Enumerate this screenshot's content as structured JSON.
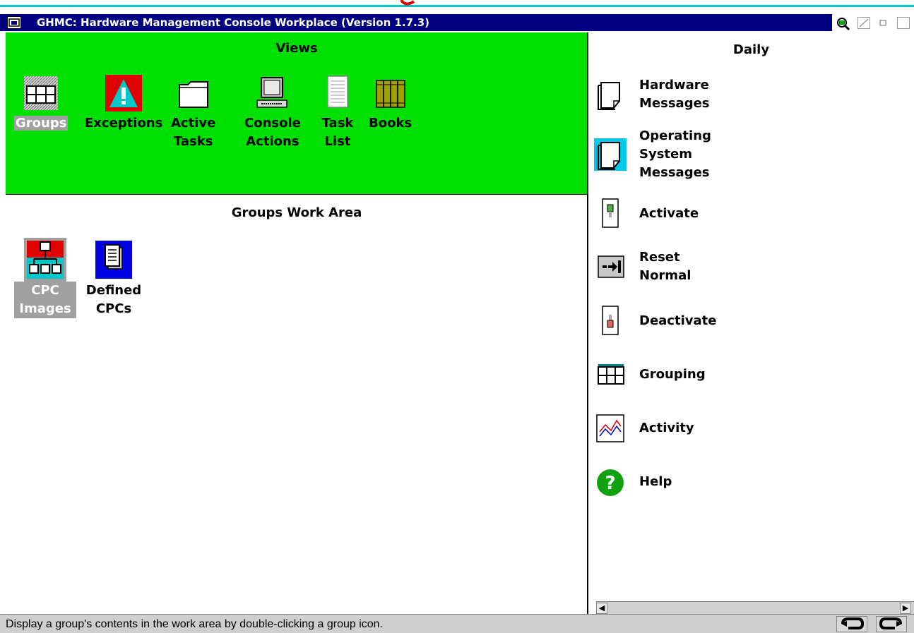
{
  "window": {
    "title": "GHMC: Hardware Management Console Workplace (Version 1.7.3)",
    "icons": [
      "system-menu-icon",
      "magnifier-icon",
      "minimize-icon",
      "restore-icon",
      "maximize-icon"
    ]
  },
  "views": {
    "header": "Views",
    "items": [
      {
        "label": "Groups",
        "icon": "groups-icon",
        "selected": true
      },
      {
        "label": "Exceptions",
        "icon": "exceptions-icon",
        "selected": false
      },
      {
        "label": "Active\nTasks",
        "icon": "folder-icon",
        "selected": false
      },
      {
        "label": "Console\nActions",
        "icon": "console-icon",
        "selected": false
      },
      {
        "label": "Task\nList",
        "icon": "task-list-icon",
        "selected": false
      },
      {
        "label": "Books",
        "icon": "books-icon",
        "selected": false
      }
    ]
  },
  "work_area": {
    "header": "Groups Work Area",
    "items": [
      {
        "label": "CPC\nImages",
        "icon": "cpc-images-icon",
        "selected": true
      },
      {
        "label": "Defined\nCPCs",
        "icon": "defined-cpcs-icon",
        "selected": false
      }
    ]
  },
  "daily": {
    "header": "Daily",
    "items": [
      {
        "label": "Hardware\nMessages",
        "icon": "document-icon"
      },
      {
        "label": "Operating\nSystem\nMessages",
        "icon": "document-icon"
      },
      {
        "label": "Activate",
        "icon": "switch-on-icon"
      },
      {
        "label": "Reset\nNormal",
        "icon": "reset-arrow-icon"
      },
      {
        "label": "Deactivate",
        "icon": "switch-off-icon"
      },
      {
        "label": "Grouping",
        "icon": "grouping-icon"
      },
      {
        "label": "Activity",
        "icon": "activity-chart-icon"
      },
      {
        "label": "Help",
        "icon": "help-icon"
      }
    ]
  },
  "status_bar": {
    "message": "Display a group's contents in the work area by double-clicking a group icon."
  },
  "colors": {
    "title_bar": "#000080",
    "views_background": "#00e000",
    "selection": "#a0a0a0",
    "accent_line": "#00c8c8"
  }
}
